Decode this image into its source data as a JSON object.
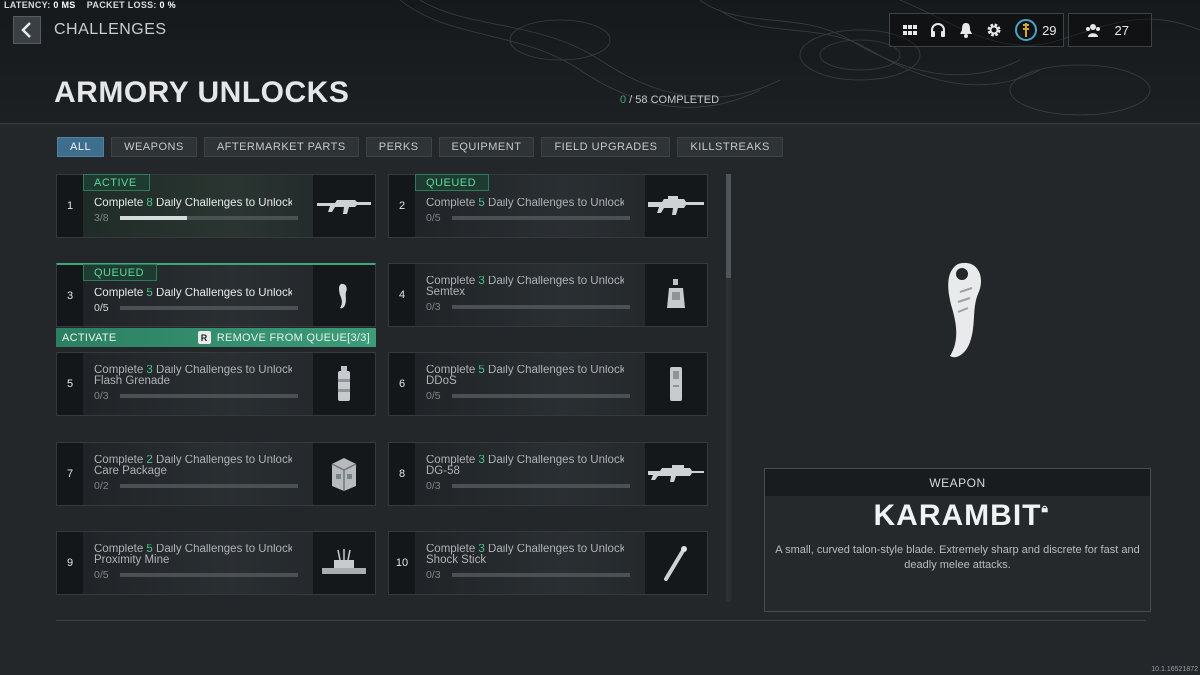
{
  "netstats": {
    "latency_label": "LATENCY:",
    "latency_value": "0 MS",
    "loss_label": "PACKET LOSS:",
    "loss_value": "0 %"
  },
  "header": {
    "breadcrumb": "CHALLENGES",
    "title": "ARMORY UNLOCKS",
    "completed_count": "0",
    "completed_rest": " / 58 COMPLETED",
    "level": "29",
    "friends": "27",
    "icons": [
      "grid-icon",
      "headset-icon",
      "bell-icon",
      "gear-icon",
      "rank-medal-icon",
      "friends-icon"
    ]
  },
  "tabs": [
    "ALL",
    "WEAPONS",
    "AFTERMARKET PARTS",
    "PERKS",
    "EQUIPMENT",
    "FIELD UPGRADES",
    "KILLSTREAKS"
  ],
  "active_tab": "ALL",
  "cards": [
    {
      "num": "1",
      "badge": "ACTIVE",
      "pre": "Complete ",
      "count": "8",
      "post": " Daily Challenges to Unlock Si",
      "line2": "",
      "progress": "3/8",
      "fraction": 0.375,
      "icon": "assault-rifle-icon"
    },
    {
      "num": "2",
      "badge": "QUEUED",
      "pre": "Complete ",
      "count": "5",
      "post": " Daily Challenges to Unlock Hi",
      "line2": "",
      "progress": "0/5",
      "fraction": 0,
      "icon": "battle-rifle-icon"
    },
    {
      "num": "3",
      "badge": "QUEUED",
      "pre": "Complete ",
      "count": "5",
      "post": " Daily Challenges to Unlock K",
      "line2": "",
      "progress": "0/5",
      "fraction": 0,
      "icon": "karambit-icon"
    },
    {
      "num": "4",
      "badge": "",
      "pre": "Complete ",
      "count": "3",
      "post": " Daily Challenges to Unlock",
      "line2": "Semtex",
      "progress": "0/3",
      "fraction": 0,
      "icon": "semtex-icon"
    },
    {
      "num": "5",
      "badge": "",
      "pre": "Complete ",
      "count": "3",
      "post": " Daily Challenges to Unlock",
      "line2": "Flash Grenade",
      "progress": "0/3",
      "fraction": 0,
      "icon": "flash-grenade-icon"
    },
    {
      "num": "6",
      "badge": "",
      "pre": "Complete ",
      "count": "5",
      "post": " Daily Challenges to Unlock",
      "line2": "DDoS",
      "progress": "0/5",
      "fraction": 0,
      "icon": "ddos-icon"
    },
    {
      "num": "7",
      "badge": "",
      "pre": "Complete ",
      "count": "2",
      "post": " Daily Challenges to Unlock",
      "line2": "Care Package",
      "progress": "0/2",
      "fraction": 0,
      "icon": "care-package-icon"
    },
    {
      "num": "8",
      "badge": "",
      "pre": "Complete ",
      "count": "3",
      "post": " Daily Challenges to Unlock",
      "line2": "DG-58",
      "progress": "0/3",
      "fraction": 0,
      "icon": "dg58-rifle-icon"
    },
    {
      "num": "9",
      "badge": "",
      "pre": "Complete ",
      "count": "5",
      "post": " Daily Challenges to Unlock",
      "line2": "Proximity Mine",
      "progress": "0/5",
      "fraction": 0,
      "icon": "proximity-mine-icon"
    },
    {
      "num": "10",
      "badge": "",
      "pre": "Complete ",
      "count": "3",
      "post": " Daily Challenges to Unlock",
      "line2": "Shock Stick",
      "progress": "0/3",
      "fraction": 0,
      "icon": "shock-stick-icon"
    }
  ],
  "queue_actions": {
    "activate": "ACTIVATE",
    "key": "R",
    "remove": "REMOVE FROM QUEUE[3/3]"
  },
  "detail": {
    "category": "WEAPON",
    "name": "KARAMBIT",
    "description": "A small, curved talon-style blade. Extremely sharp and discrete for fast and deadly melee attacks."
  },
  "version": "10.1.16521872",
  "colors": {
    "accent_green": "#3fa66f",
    "tab_active": "#3d6e8d"
  }
}
